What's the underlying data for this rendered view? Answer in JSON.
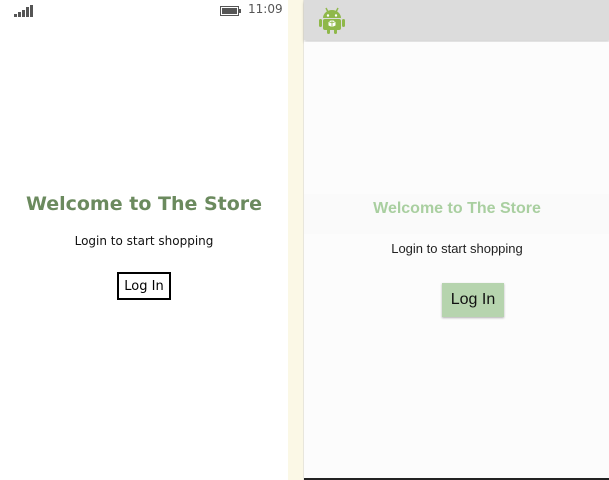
{
  "windows_phone": {
    "status_bar": {
      "signal_icon": "signal-strength-icon",
      "battery_icon": "battery-icon",
      "time": "11:09"
    },
    "welcome_title": "Welcome to The Store",
    "subtitle": "Login to start shopping",
    "login_button_label": "Log In"
  },
  "android": {
    "action_bar": {
      "app_icon": "android-robot-icon"
    },
    "welcome_title": "Welcome to The Store",
    "subtitle": "Login to start shopping",
    "login_button_label": "Log In"
  },
  "colors": {
    "wp_title": "#6b8a5e",
    "android_title": "#a9cfa0",
    "android_button": "#b6d4ae",
    "android_action_bar": "#dcdcdc",
    "android_robot": "#8fb84a"
  }
}
